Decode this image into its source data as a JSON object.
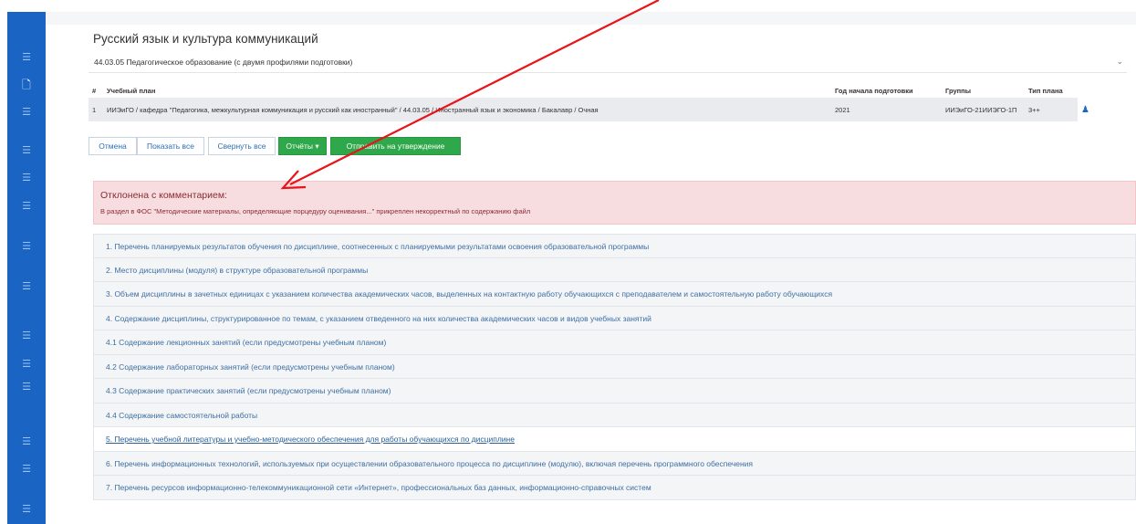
{
  "page_title": "Русский язык и культура коммуникаций",
  "program": {
    "selected": "44.03.05 Педагогическое образование (с двумя профилями подготовки)",
    "chevron_icon": "chevron-down-icon"
  },
  "plan_table": {
    "headers": {
      "num": "#",
      "plan": "Учебный план",
      "year": "Год начала подготовки",
      "groups": "Группы",
      "type": "Тип плана"
    },
    "row": {
      "num": "1",
      "plan": "ИИЭиГО / кафедра \"Педагогика, межкультурная коммуникация и русский как иностранный\" / 44.03.05 / Иностранный язык и экономика / Бакалавр / Очная",
      "year": "2021",
      "groups": "ИИЭиГО-21ИИЭГО-1П",
      "type": "3++",
      "action_icon": "users-icon"
    }
  },
  "toolbar": {
    "cancel": "Отмена",
    "show_all": "Показать все",
    "collapse_all": "Свернуть все",
    "reports": "Отчёты",
    "reports_caret": "▾",
    "submit": "Отправить на утверждение"
  },
  "alert": {
    "heading": "Отклонена с комментарием:",
    "body": "В раздел в ФОС \"Методические материалы, определяющие порцедуру оценивания...\" прикреплен некорректный по содержанию файл"
  },
  "sections": [
    "1. Перечень планируемых результатов обучения по дисциплине, соотнесенных с планируемыми результатами освоения образовательной программы",
    "2. Место дисциплины (модуля) в структуре образовательной программы",
    "3. Объем дисциплины в зачетных единицах с указанием количества академических часов, выделенных на контактную работу обучающихся с преподавателем и самостоятельную работу обучающихся",
    "4. Содержание дисциплины, структурированное по темам, с указанием отведенного на них количества академических часов и видов учебных занятий",
    "4.1 Содержание лекционных занятий (если предусмотрены учебным планом)",
    "4.2 Содержание лабораторных занятий (если предусмотрены учебным планом)",
    "4.3 Содержание практических занятий (если предусмотрены учебным планом)",
    "4.4 Содержание самостоятельной работы",
    "5. Перечень учебной литературы и учебно-методического обеспечения для работы обучающихся по дисциплине",
    "6. Перечень информационных технологий, используемых при осуществлении образовательного процесса по дисциплине (модулю), включая перечень программного обеспечения",
    "7. Перечень ресурсов информационно-телекоммуникационной сети «Интернет», профессиональных баз данных, информационно-справочных систем"
  ],
  "sidebar_icons": [
    "menu-icon",
    "document-icon",
    "menu-icon",
    "menu-icon",
    "menu-icon",
    "menu-icon",
    "menu-icon",
    "menu-icon",
    "menu-icon",
    "menu-icon",
    "menu-icon",
    "menu-icon",
    "menu-icon",
    "menu-icon"
  ],
  "colors": {
    "sidebar": "#1a65c4",
    "alert_bg": "#f7dde0",
    "alert_text": "#8a2b33",
    "green_button": "#2ea84a",
    "annotation_arrow": "#e8141a"
  }
}
